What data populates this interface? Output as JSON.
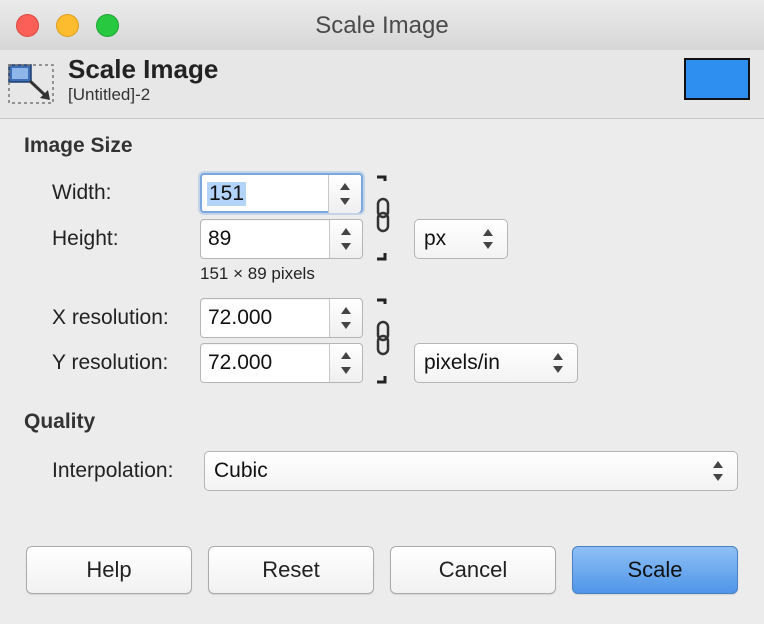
{
  "window": {
    "title": "Scale Image"
  },
  "header": {
    "title": "Scale Image",
    "subtitle": "[Untitled]-2",
    "swatch_color": "#2e8ff0"
  },
  "image_size": {
    "section_label": "Image Size",
    "width_label": "Width:",
    "width_value": "151",
    "height_label": "Height:",
    "height_value": "89",
    "size_info": "151 × 89 pixels",
    "unit": "px",
    "xres_label": "X resolution:",
    "xres_value": "72.000",
    "yres_label": "Y resolution:",
    "yres_value": "72.000",
    "res_unit": "pixels/in"
  },
  "quality": {
    "section_label": "Quality",
    "interp_label": "Interpolation:",
    "interp_value": "Cubic"
  },
  "buttons": {
    "help": "Help",
    "reset": "Reset",
    "cancel": "Cancel",
    "scale": "Scale"
  }
}
